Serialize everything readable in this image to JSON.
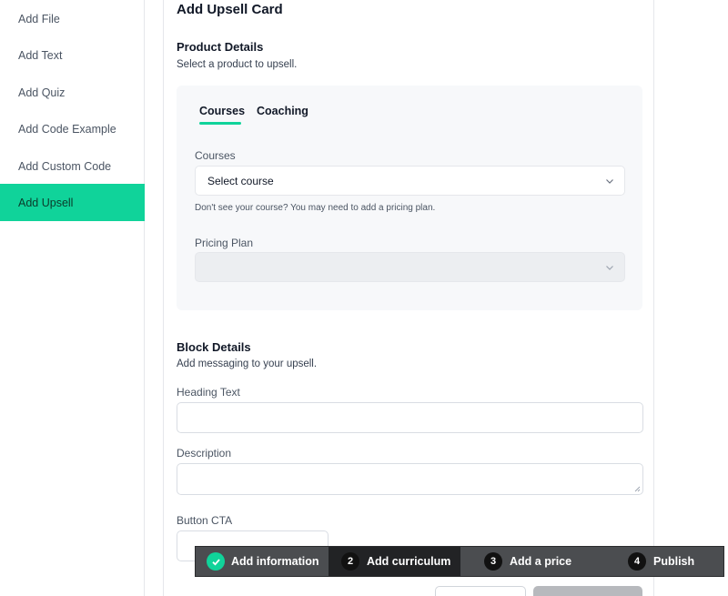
{
  "sidebar": {
    "items": [
      {
        "label": "Add File"
      },
      {
        "label": "Add Text"
      },
      {
        "label": "Add Quiz"
      },
      {
        "label": "Add Code Example"
      },
      {
        "label": "Add Custom Code"
      },
      {
        "label": "Add Upsell",
        "active": true
      }
    ]
  },
  "card": {
    "title": "Add Upsell Card",
    "product": {
      "title": "Product Details",
      "subtitle": "Select a product to upsell.",
      "tabs": [
        "Courses",
        "Coaching"
      ],
      "courses_label": "Courses",
      "courses_value": "Select course",
      "courses_hint": "Don't see your course? You may need to add a pricing plan.",
      "pricing_label": "Pricing Plan",
      "pricing_value": ""
    },
    "block": {
      "title": "Block Details",
      "subtitle": "Add messaging to your upsell.",
      "heading_label": "Heading Text",
      "heading_value": "",
      "description_label": "Description",
      "description_value": "",
      "cta_label": "Button CTA",
      "cta_value": ""
    }
  },
  "stepper": {
    "steps": [
      {
        "number": "",
        "label": "Add information",
        "state": "done"
      },
      {
        "number": "2",
        "label": "Add curriculum",
        "state": "current"
      },
      {
        "number": "3",
        "label": "Add a price",
        "state": "todo"
      },
      {
        "number": "4",
        "label": "Publish",
        "state": "todo"
      }
    ]
  },
  "colors": {
    "accent": "#10d39a",
    "stepper_bg": "#4b4d50",
    "stepper_current": "#222325"
  }
}
